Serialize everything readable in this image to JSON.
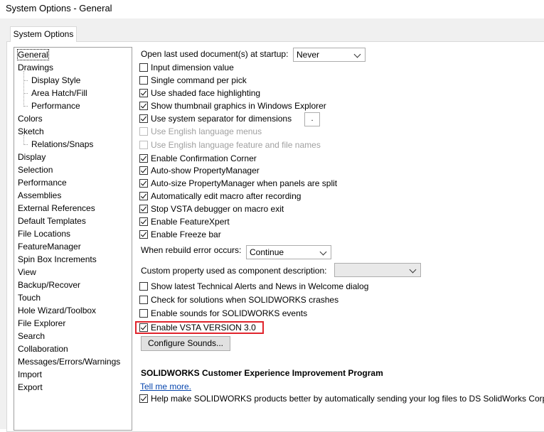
{
  "window": {
    "title": "System Options - General"
  },
  "tab": {
    "label": "System Options"
  },
  "tree": [
    {
      "label": "General",
      "level": 0,
      "selected": true
    },
    {
      "label": "Drawings",
      "level": 0
    },
    {
      "label": "Display Style",
      "level": 1
    },
    {
      "label": "Area Hatch/Fill",
      "level": 1
    },
    {
      "label": "Performance",
      "level": 1
    },
    {
      "label": "Colors",
      "level": 0
    },
    {
      "label": "Sketch",
      "level": 0
    },
    {
      "label": "Relations/Snaps",
      "level": 1
    },
    {
      "label": "Display",
      "level": 0
    },
    {
      "label": "Selection",
      "level": 0
    },
    {
      "label": "Performance",
      "level": 0
    },
    {
      "label": "Assemblies",
      "level": 0
    },
    {
      "label": "External References",
      "level": 0
    },
    {
      "label": "Default Templates",
      "level": 0
    },
    {
      "label": "File Locations",
      "level": 0
    },
    {
      "label": "FeatureManager",
      "level": 0
    },
    {
      "label": "Spin Box Increments",
      "level": 0
    },
    {
      "label": "View",
      "level": 0
    },
    {
      "label": "Backup/Recover",
      "level": 0
    },
    {
      "label": "Touch",
      "level": 0
    },
    {
      "label": "Hole Wizard/Toolbox",
      "level": 0
    },
    {
      "label": "File Explorer",
      "level": 0
    },
    {
      "label": "Search",
      "level": 0
    },
    {
      "label": "Collaboration",
      "level": 0
    },
    {
      "label": "Messages/Errors/Warnings",
      "level": 0
    },
    {
      "label": "Import",
      "level": 0
    },
    {
      "label": "Export",
      "level": 0
    }
  ],
  "startup": {
    "label": "Open last used document(s) at startup:",
    "value": "Never"
  },
  "options_a": [
    {
      "label": "Input dimension value",
      "checked": false
    },
    {
      "label": "Single command per pick",
      "checked": false
    },
    {
      "label": "Use shaded face highlighting",
      "checked": true
    },
    {
      "label": "Show thumbnail graphics in Windows Explorer",
      "checked": true
    },
    {
      "label": "Use system separator for dimensions",
      "checked": true
    },
    {
      "label": "Use English language menus",
      "checked": false,
      "disabled": true
    },
    {
      "label": "Use English language feature and file names",
      "checked": false,
      "disabled": true
    },
    {
      "label": "Enable Confirmation Corner",
      "checked": true
    },
    {
      "label": "Auto-show PropertyManager",
      "checked": true
    },
    {
      "label": "Auto-size PropertyManager when panels are split",
      "checked": true
    },
    {
      "label": "Automatically edit macro after recording",
      "checked": true
    },
    {
      "label": "Stop VSTA debugger on macro exit",
      "checked": true
    },
    {
      "label": "Enable FeatureXpert",
      "checked": true
    },
    {
      "label": "Enable Freeze bar",
      "checked": true
    }
  ],
  "separator_value": ".",
  "rebuild": {
    "label": "When rebuild error occurs:",
    "value": "Continue"
  },
  "custom_prop": {
    "label": "Custom property used as component description:",
    "value": ""
  },
  "options_b": [
    {
      "label": "Show latest Technical Alerts and News in Welcome dialog",
      "checked": false
    },
    {
      "label": "Check for solutions when SOLIDWORKS crashes",
      "checked": false
    },
    {
      "label": "Enable sounds for SOLIDWORKS events",
      "checked": false
    },
    {
      "label": "Enable VSTA VERSION 3.0",
      "checked": true
    }
  ],
  "configure_sounds_label": "Configure Sounds...",
  "ceip": {
    "title": "SOLIDWORKS Customer Experience Improvement Program",
    "link": "Tell me more.",
    "option": {
      "label": "Help make SOLIDWORKS products better by automatically sending your log files to DS SolidWorks Corporat",
      "checked": true
    }
  },
  "colors": {
    "highlight": "#e0242c",
    "link": "#0645ad"
  }
}
